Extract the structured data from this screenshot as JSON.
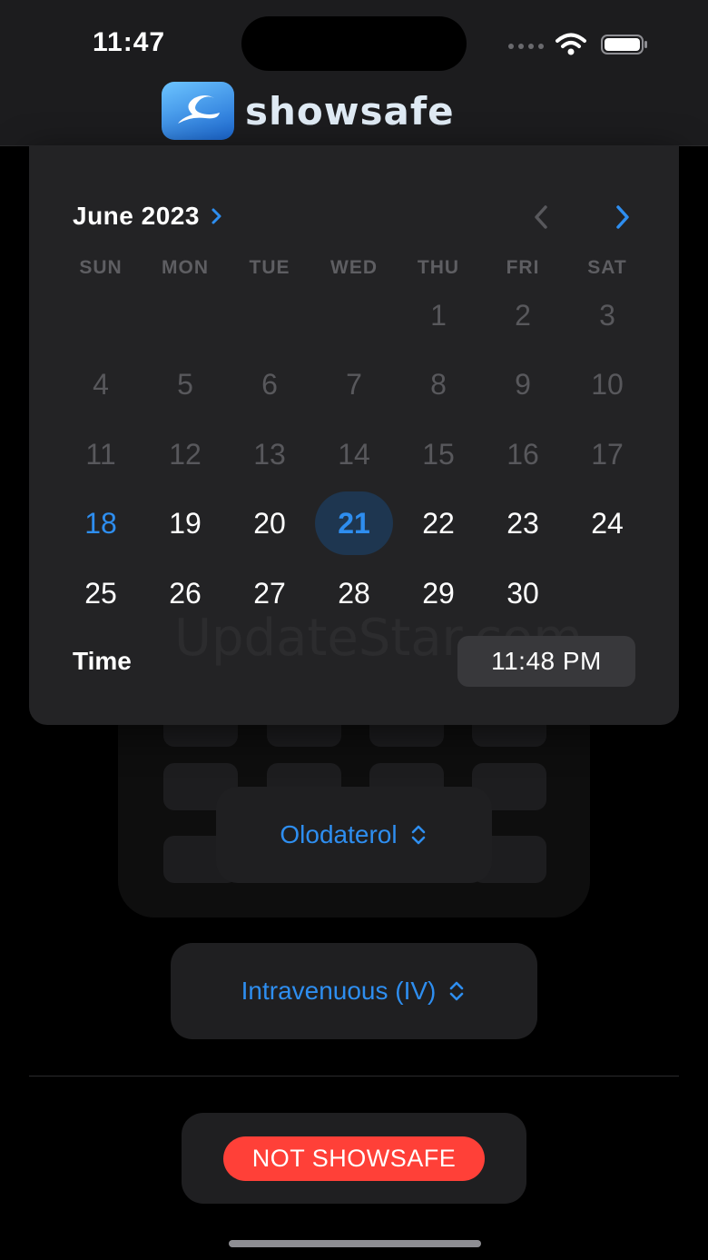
{
  "status_bar": {
    "time": "11:47"
  },
  "header": {
    "brand": "showsafe"
  },
  "calendar": {
    "month_label": "June 2023",
    "weekdays": [
      "SUN",
      "MON",
      "TUE",
      "WED",
      "THU",
      "FRI",
      "SAT"
    ],
    "weeks": [
      [
        "",
        "",
        "",
        "",
        "1",
        "2",
        "3"
      ],
      [
        "4",
        "5",
        "6",
        "7",
        "8",
        "9",
        "10"
      ],
      [
        "11",
        "12",
        "13",
        "14",
        "15",
        "16",
        "17"
      ],
      [
        "18",
        "19",
        "20",
        "21",
        "22",
        "23",
        "24"
      ],
      [
        "25",
        "26",
        "27",
        "28",
        "29",
        "30",
        ""
      ]
    ],
    "today": "18",
    "selected": "21",
    "time_label": "Time",
    "time_value": "11:48 PM",
    "watermark": "UpdateStar.com",
    "accent_color": "#2e8ef0"
  },
  "medication": {
    "drug": "Olodaterol",
    "route": "Intravenuous (IV)"
  },
  "result": {
    "status": "NOT SHOWSAFE",
    "status_color": "#ff4038"
  },
  "icons": [
    "wifi-icon",
    "battery-icon",
    "chevron-right-icon",
    "chevron-left-icon",
    "chevron-up-down-icon",
    "brand-logo-icon"
  ]
}
